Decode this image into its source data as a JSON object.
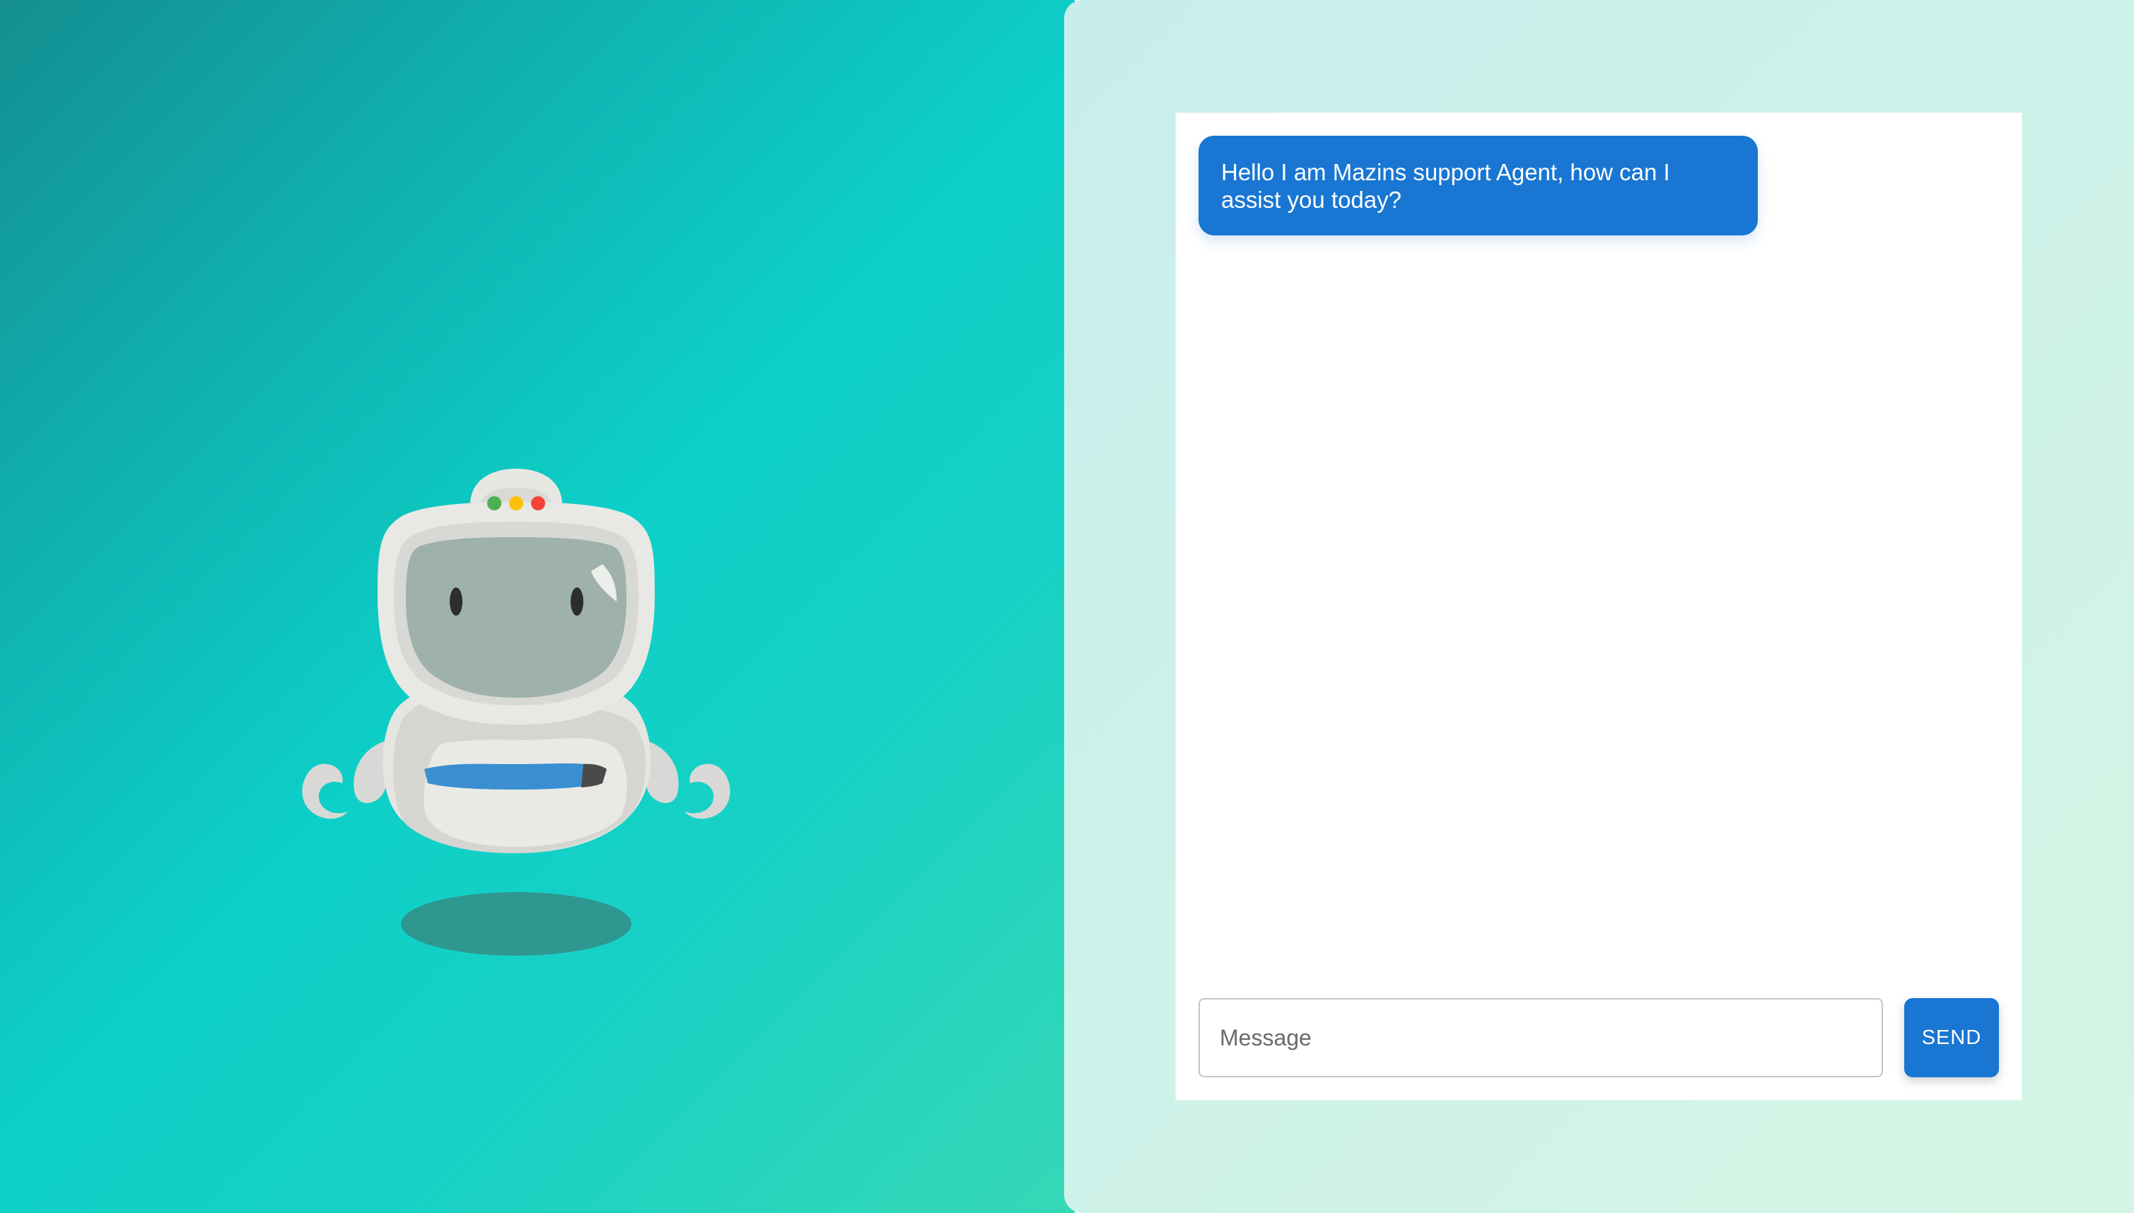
{
  "chat": {
    "messages": [
      {
        "sender": "agent",
        "text": "Hello I am Mazins support Agent, how can I assist you today?"
      }
    ],
    "input": {
      "value": "",
      "placeholder": "Message"
    },
    "send_label": "SEND"
  },
  "illustration": {
    "icon": "robot-mascot-icon",
    "indicator_lights": [
      "#4caf50",
      "#ffc107",
      "#f44336"
    ]
  },
  "colors": {
    "accent": "#1976d2",
    "left_gradient": [
      "#148e90",
      "#0dd0c8",
      "#36d8b6"
    ],
    "right_gradient": [
      "#c8eeec",
      "#d4f5e3"
    ]
  }
}
